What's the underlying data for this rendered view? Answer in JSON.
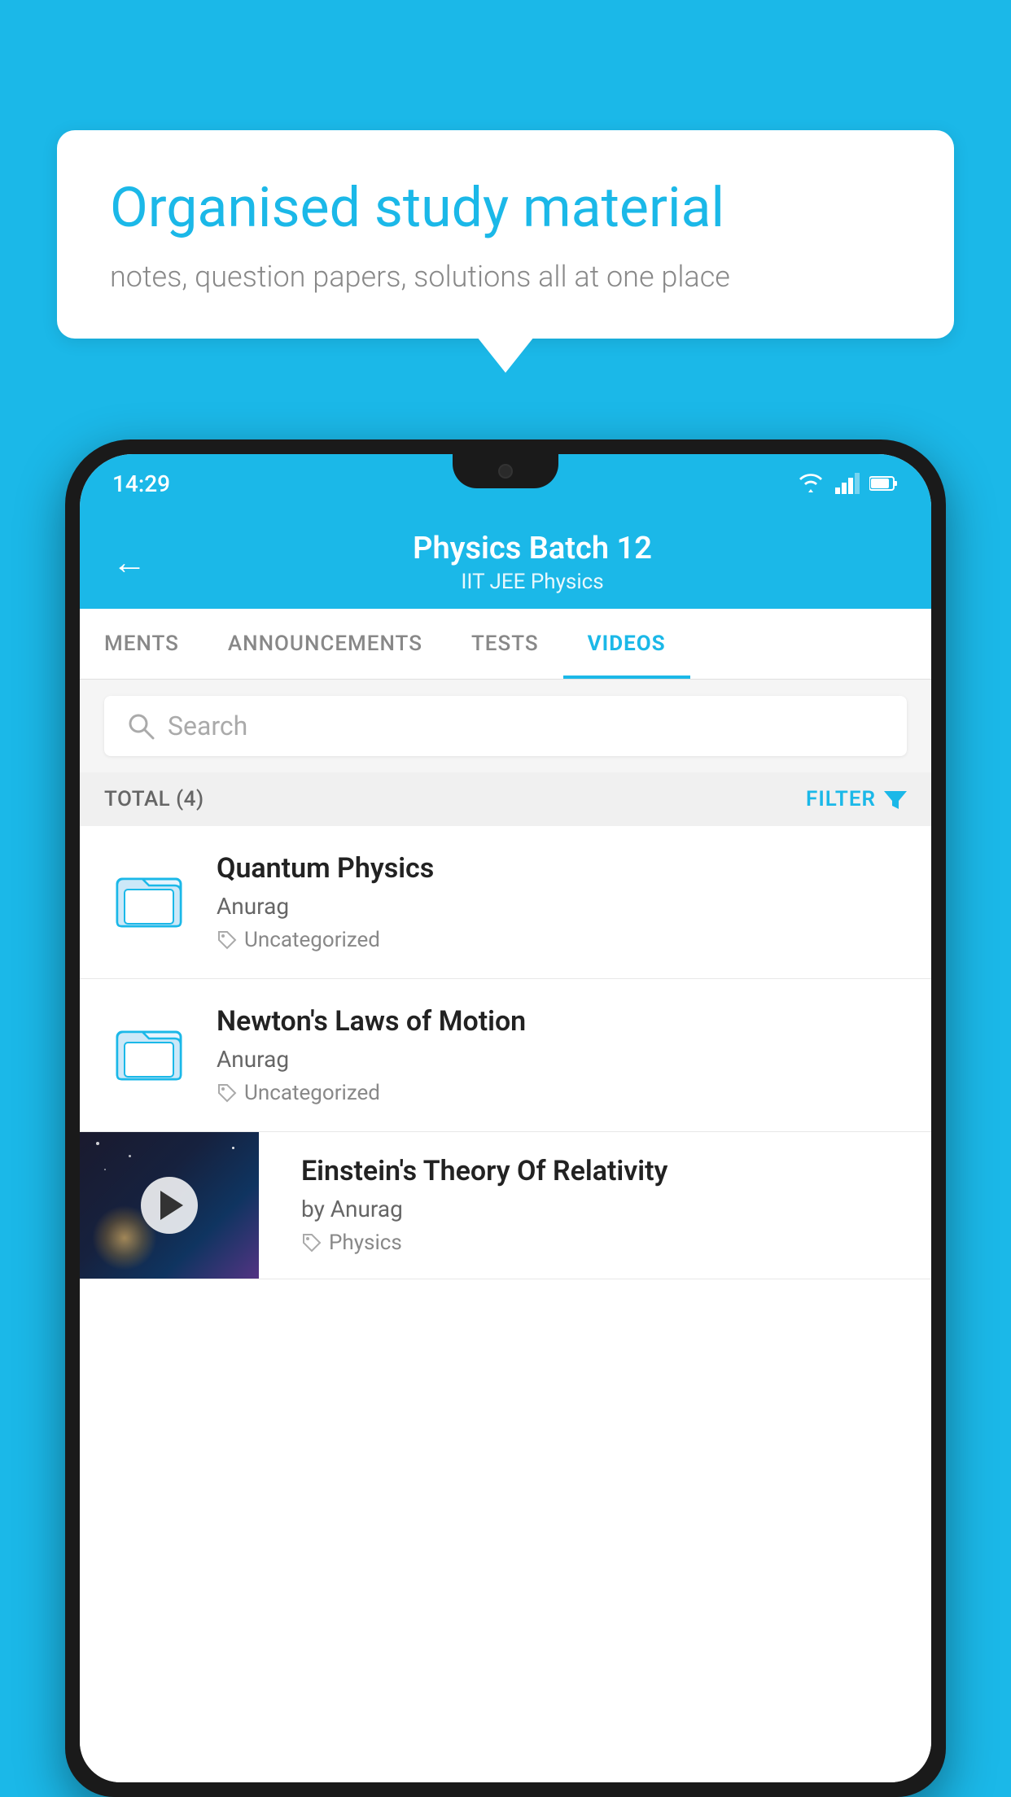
{
  "background_color": "#1bb8e8",
  "speech_bubble": {
    "headline": "Organised study material",
    "subtext": "notes, question papers, solutions all at one place"
  },
  "phone": {
    "status_bar": {
      "time": "14:29",
      "icons": [
        "wifi",
        "signal",
        "battery"
      ]
    },
    "header": {
      "back_label": "←",
      "title": "Physics Batch 12",
      "subtitle": "IIT JEE   Physics"
    },
    "tabs": [
      {
        "label": "MENTS",
        "active": false
      },
      {
        "label": "ANNOUNCEMENTS",
        "active": false
      },
      {
        "label": "TESTS",
        "active": false
      },
      {
        "label": "VIDEOS",
        "active": true
      }
    ],
    "search": {
      "placeholder": "Search"
    },
    "filter_bar": {
      "total_label": "TOTAL (4)",
      "filter_label": "FILTER"
    },
    "videos": [
      {
        "id": 1,
        "title": "Quantum Physics",
        "author": "Anurag",
        "tag": "Uncategorized",
        "type": "folder"
      },
      {
        "id": 2,
        "title": "Newton's Laws of Motion",
        "author": "Anurag",
        "tag": "Uncategorized",
        "type": "folder"
      },
      {
        "id": 3,
        "title": "Einstein's Theory Of Relativity",
        "author": "by Anurag",
        "tag": "Physics",
        "type": "video"
      }
    ]
  }
}
